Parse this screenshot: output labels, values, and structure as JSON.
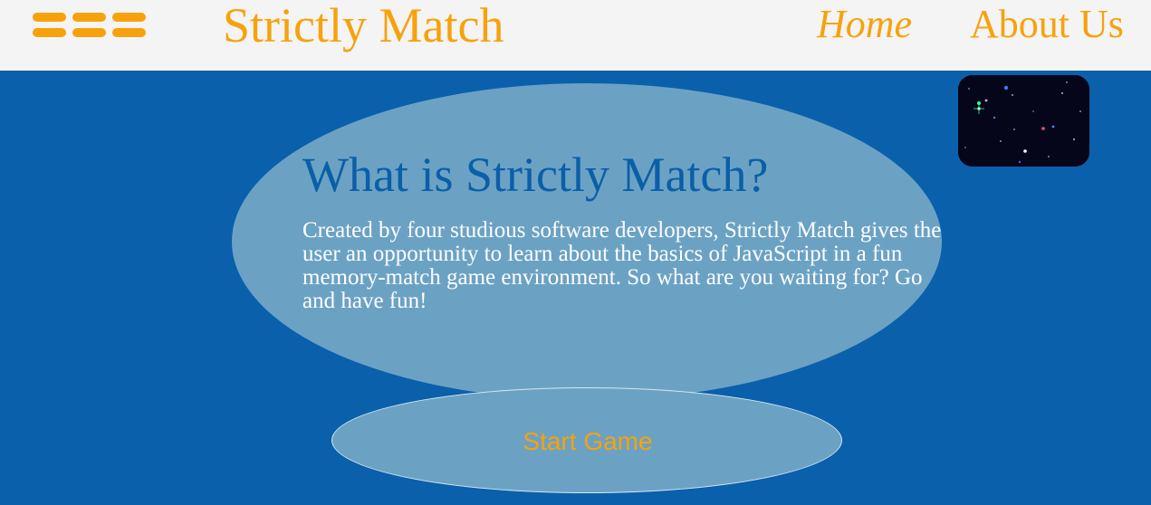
{
  "navbar": {
    "menu_icon": "hamburger-menu-icon",
    "brand": "Strictly Match",
    "links": {
      "home": "Home",
      "about": "About Us"
    }
  },
  "hero": {
    "title": "What is Strictly Match?",
    "description": "Created by four studious software developers, Strictly Match gives the user an opportunity to learn about the basics of JavaScript in a fun memory-match game environment. So what are you waiting for? Go and have fun!"
  },
  "actions": {
    "start_label": "Start Game"
  },
  "colors": {
    "accent": "#f7a20c",
    "background": "#0a60ab",
    "navbar": "#f4f4f4",
    "bubble": "#6ba2c4",
    "title": "#0a5fa8"
  }
}
